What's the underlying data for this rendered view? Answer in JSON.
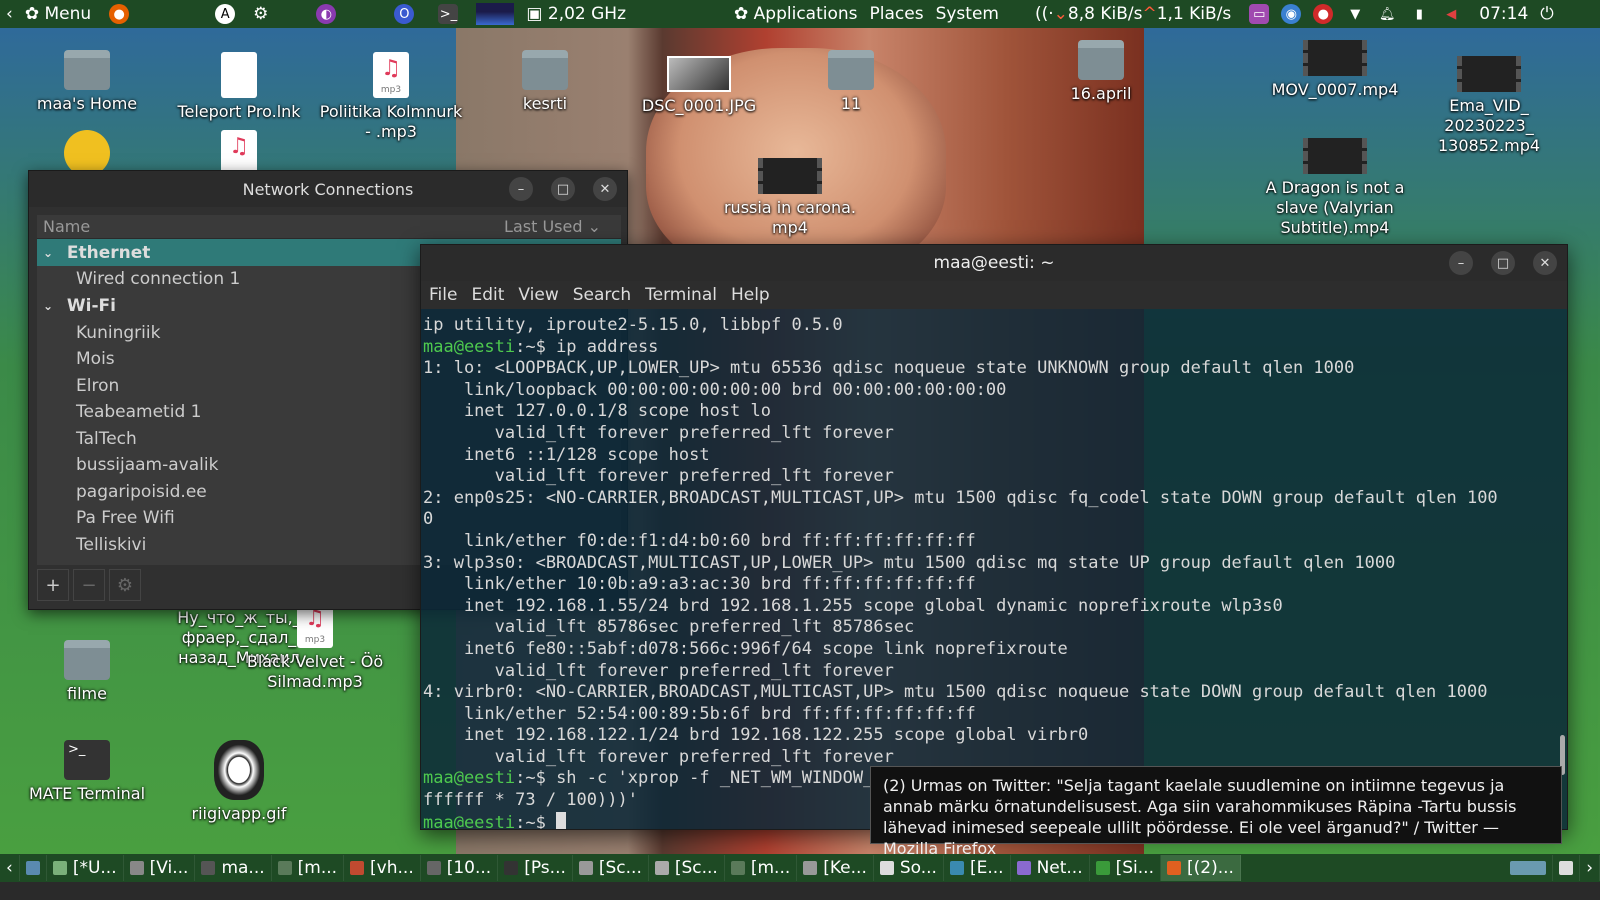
{
  "top_panel": {
    "menu_label": "Menu",
    "cpu_freq": "2,02 GHz",
    "applications": "Applications",
    "places": "Places",
    "system": "System",
    "net_down": "8,8 KiB/s",
    "net_up": "1,1 KiB/s",
    "clock": "07:14"
  },
  "desktop": {
    "icons": {
      "home": "maa's Home",
      "teleport": "Teleport Pro.lnk",
      "poliitika": "Poliitika Kolmnurk - .mp3",
      "kesrti": "kesrti",
      "dsc": "DSC_0001.JPG",
      "eleven": "11",
      "april": "16.april",
      "mov": "MOV_0007.mp4",
      "ema": "Ema_VID_ 20230223_ 130852.mp4",
      "russia": "russia in carona. mp4",
      "dragon": "A Dragon is not a slave (Valyrian Subtitle).mp4",
      "nu": "Ну_что_ж_ты,_ фраер,_сдал_ назад_Михаил",
      "black_velvet": "Black Velvet - Öö Silmad.mp3",
      "filme": "filme",
      "mate_terminal": "MATE Terminal",
      "riigivapp": "riigivapp.gif",
      "mp3_badge": "mp3"
    }
  },
  "netwin": {
    "title": "Network Connections",
    "col_name": "Name",
    "col_last_used": "Last Used",
    "groups": [
      {
        "label": "Ethernet",
        "items": [
          "Wired connection 1"
        ]
      },
      {
        "label": "Wi-Fi",
        "items": [
          "Kuningriik",
          "Mois",
          "Elron",
          "Teabeametid 1",
          "TalTech",
          "bussijaam-avalik",
          "pagaripoisid.ee",
          "Pa Free Wifi",
          "Telliskivi"
        ]
      }
    ],
    "footer": {
      "add": "+",
      "remove": "−",
      "settings": "⚙"
    }
  },
  "terminal": {
    "title": "maa@eesti: ~",
    "menu": [
      "File",
      "Edit",
      "View",
      "Search",
      "Terminal",
      "Help"
    ],
    "prompt": "maa@eesti",
    "lines": [
      {
        "t": "ip utility, iproute2-5.15.0, libbpf 0.5.0"
      },
      {
        "p": "maa@eesti",
        "t": ":~$ ip address"
      },
      {
        "t": "1: lo: <LOOPBACK,UP,LOWER_UP> mtu 65536 qdisc noqueue state UNKNOWN group default qlen 1000"
      },
      {
        "t": "    link/loopback 00:00:00:00:00:00 brd 00:00:00:00:00:00"
      },
      {
        "t": "    inet 127.0.0.1/8 scope host lo"
      },
      {
        "t": "       valid_lft forever preferred_lft forever"
      },
      {
        "t": "    inet6 ::1/128 scope host"
      },
      {
        "t": "       valid_lft forever preferred_lft forever"
      },
      {
        "t": "2: enp0s25: <NO-CARRIER,BROADCAST,MULTICAST,UP> mtu 1500 qdisc fq_codel state DOWN group default qlen 100"
      },
      {
        "t": "0"
      },
      {
        "t": "    link/ether f0:de:f1:d4:b0:60 brd ff:ff:ff:ff:ff:ff"
      },
      {
        "t": "3: wlp3s0: <BROADCAST,MULTICAST,UP,LOWER_UP> mtu 1500 qdisc mq state UP group default qlen 1000"
      },
      {
        "t": "    link/ether 10:0b:a9:a3:ac:30 brd ff:ff:ff:ff:ff:ff"
      },
      {
        "t": "    inet 192.168.1.55/24 brd 192.168.1.255 scope global dynamic noprefixroute wlp3s0"
      },
      {
        "t": "       valid_lft 85786sec preferred_lft 85786sec"
      },
      {
        "t": "    inet6 fe80::5abf:d078:566c:996f/64 scope link noprefixroute"
      },
      {
        "t": "       valid_lft forever preferred_lft forever"
      },
      {
        "t": "4: virbr0: <NO-CARRIER,BROADCAST,MULTICAST,UP> mtu 1500 qdisc noqueue state DOWN group default qlen 1000"
      },
      {
        "t": "    link/ether 52:54:00:89:5b:6f brd ff:ff:ff:ff:ff:ff"
      },
      {
        "t": "    inet 192.168.122.1/24 brd 192.168.122.255 scope global virbr0"
      },
      {
        "t": "       valid_lft forever preferred_lft forever"
      },
      {
        "p": "maa@eesti",
        "t": ":~$ sh -c 'xprop -f _NET_WM_WINDOW_OPACITY 32c -set _NET_WM_WINDOW_OPACITY $(printf 0x%x $((0xff"
      },
      {
        "t": "ffffff * 73 / 100)))'"
      },
      {
        "p": "maa@eesti",
        "t": ":~$ ",
        "cursor": true
      }
    ]
  },
  "tooltip": {
    "text": "(2) Urmas on Twitter: \"Selja tagant kaelale suudlemine on intiimne tegevus ja annab märku õrnatundelisusest. Aga siin varahommikuses Räpina -Tartu bussis lähevad inimesed seepeale ullilt pöördesse. Ei ole veel ärganud?\" / Twitter — Mozilla Firefox"
  },
  "taskbar": {
    "tasks": [
      "[*U...",
      "[Vi...",
      "ma...",
      "[m...",
      "[vh...",
      "[10...",
      "[Ps...",
      "[Sc...",
      "[Sc...",
      "[m...",
      "[Ke...",
      "So...",
      "[E...",
      "Net...",
      "[Si...",
      "[(2)..."
    ]
  },
  "colors": {
    "panel": "#1e4a24",
    "prompt_green": "#4ec94e",
    "selection_teal": "#2f7a78"
  }
}
